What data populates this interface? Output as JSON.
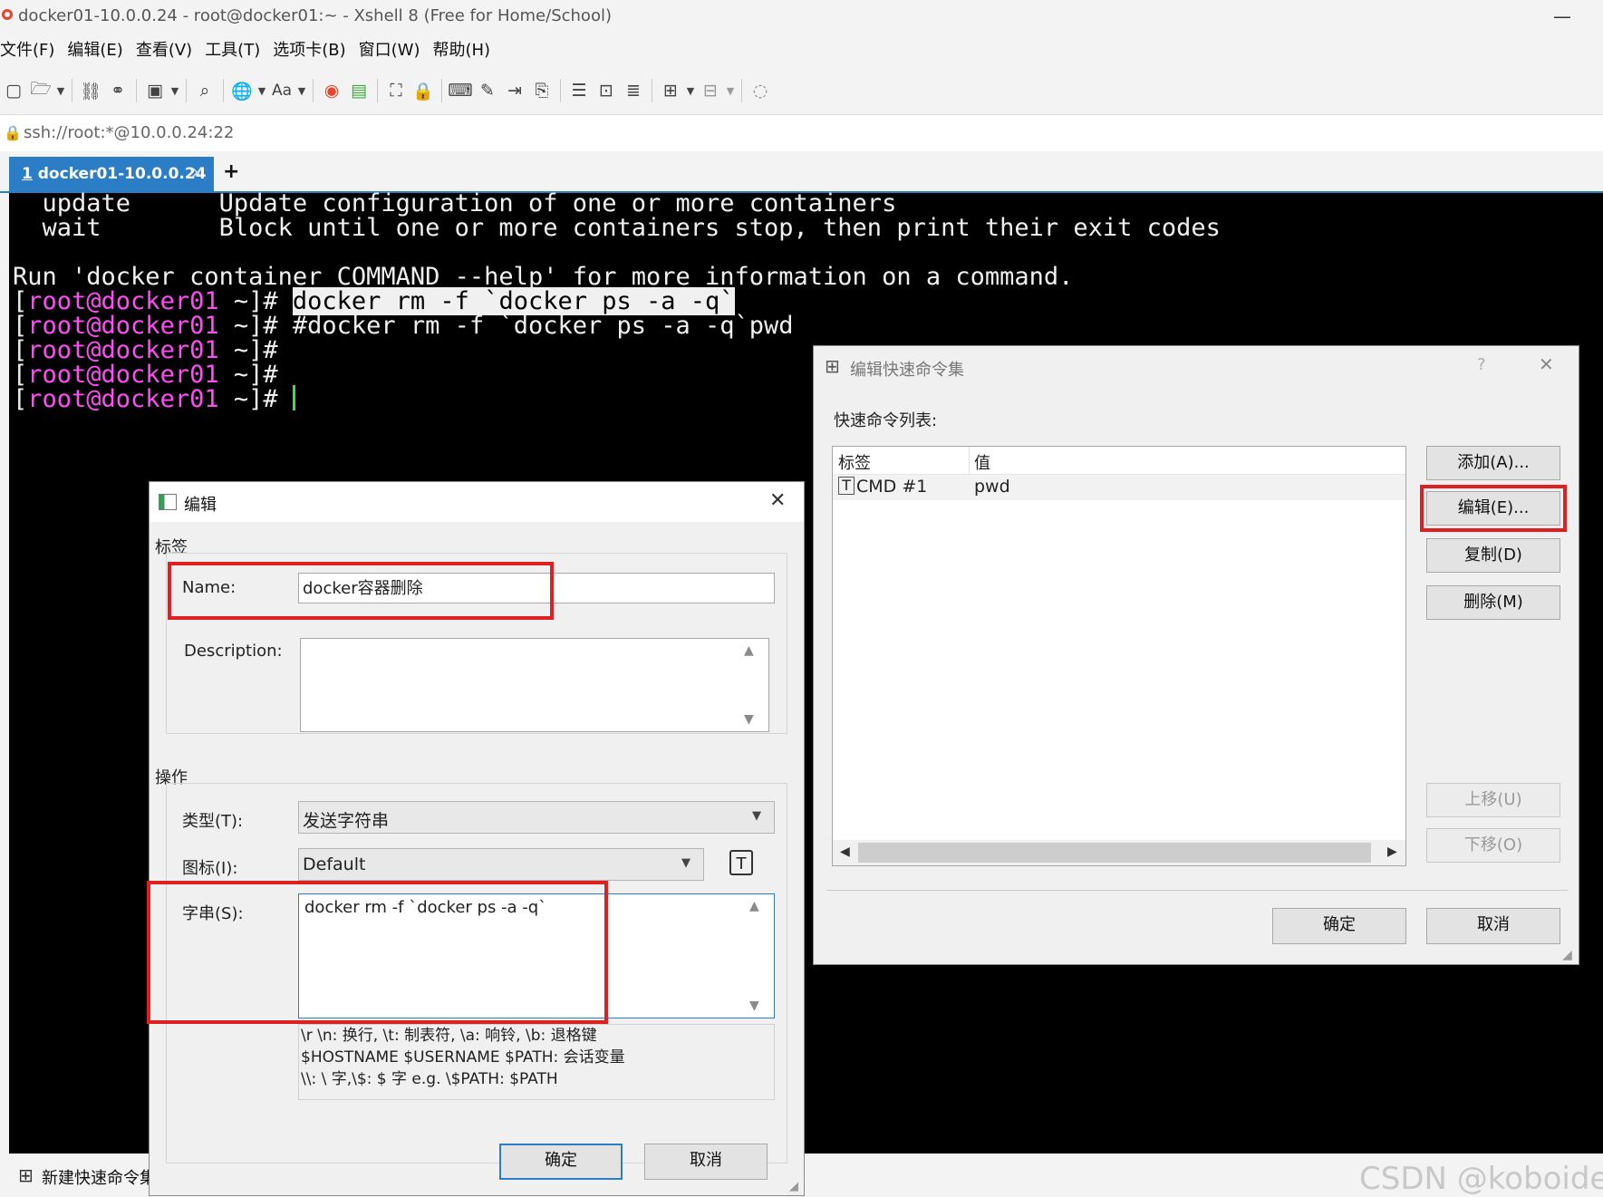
{
  "window": {
    "title": "docker01-10.0.0.24 - root@docker01:~ - Xshell 8 (Free for Home/School)",
    "app_icon": "xshell-logo-icon"
  },
  "menu": [
    "文件(F)",
    "编辑(E)",
    "查看(V)",
    "工具(T)",
    "选项卡(B)",
    "窗口(W)",
    "帮助(H)"
  ],
  "toolbar": {
    "font_label": "Aa"
  },
  "address": {
    "url": "ssh://root:*@10.0.0.24:22"
  },
  "tabs": [
    {
      "number": "1",
      "label": "docker01-10.0.0.24",
      "close": "×"
    }
  ],
  "add_tab": "+",
  "terminal": {
    "lines": [
      "  update      Update configuration of one or more containers",
      "  wait        Block until one or more containers stop, then print their exit codes",
      "",
      "Run 'docker container COMMAND --help' for more information on a command."
    ],
    "prompt_open": "[",
    "prompt_user": "root@docker01",
    "prompt_close": " ~]# ",
    "commands": [
      "docker rm -f `docker ps -a -q`",
      "#docker rm -f `docker ps -a -q`pwd",
      "",
      "",
      ""
    ]
  },
  "status": {
    "quick_commands_label": "新建快速命令集",
    "watermark": "CSDN @koboides"
  },
  "edit_dialog": {
    "title": "编辑",
    "close": "✕",
    "group_label": "标签",
    "name_label": "Name:",
    "name_value": "docker容器删除",
    "description_label": "Description:",
    "description_value": "",
    "group_action": "操作",
    "type_label": "类型(T):",
    "type_value": "发送字符串",
    "icon_label": "图标(I):",
    "icon_value": "Default",
    "string_label": "字串(S):",
    "string_value": "docker rm -f `docker ps -a -q`",
    "hint_lines": [
      "\\r \\n: 换行, \\t: 制表符, \\a: 响铃, \\b: 退格键",
      "$HOSTNAME $USERNAME $PATH: 会话变量",
      "\\\\: \\ 字,\\$: $ 字 e.g. \\$PATH: $PATH"
    ],
    "ok": "确定",
    "cancel": "取消"
  },
  "qc_dialog": {
    "title": "编辑快速命令集",
    "help": "?",
    "close": "✕",
    "list_label": "快速命令列表:",
    "columns": [
      "标签",
      "值"
    ],
    "rows": [
      {
        "label": "CMD #1",
        "value": "pwd"
      }
    ],
    "buttons": {
      "add": "添加(A)...",
      "edit": "编辑(E)...",
      "copy": "复制(D)",
      "delete": "删除(M)",
      "up": "上移(U)",
      "down": "下移(O)"
    },
    "ok": "确定",
    "cancel": "取消"
  },
  "colors": {
    "accent": "#2b7dc6",
    "highlight": "#e02020",
    "prompt": "#ff4cf5",
    "cursor": "#36e04a"
  }
}
